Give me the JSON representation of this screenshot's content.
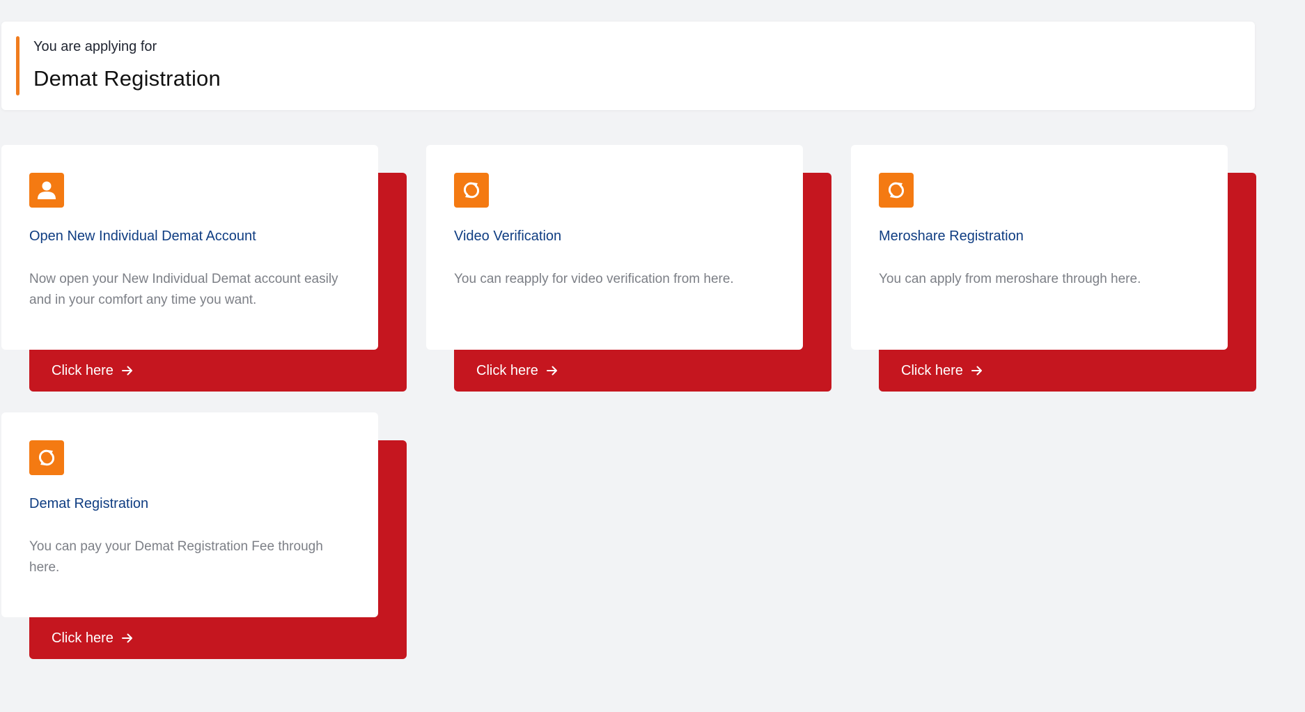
{
  "header": {
    "subtitle": "You are applying for",
    "title": "Demat Registration",
    "accent_color": "#f07c1e"
  },
  "colors": {
    "card_back": "#c5161f",
    "icon_bg": "#f47a12",
    "title_text": "#0f3d82",
    "desc_text": "#7c7f86"
  },
  "cards": [
    {
      "icon": "user-icon",
      "title": "Open New Individual Demat Account",
      "description": "Now open your New Individual Demat account easily and in your comfort any time you want.",
      "action_label": "Click here"
    },
    {
      "icon": "refresh-icon",
      "title": "Video Verification",
      "description": "You can reapply for video verification from here.",
      "action_label": "Click here"
    },
    {
      "icon": "refresh-icon",
      "title": "Meroshare Registration",
      "description": "You can apply from meroshare through here.",
      "action_label": "Click here"
    },
    {
      "icon": "refresh-icon",
      "title": "Demat Registration",
      "description": "You can pay your Demat Registration Fee through here.",
      "action_label": "Click here"
    }
  ]
}
